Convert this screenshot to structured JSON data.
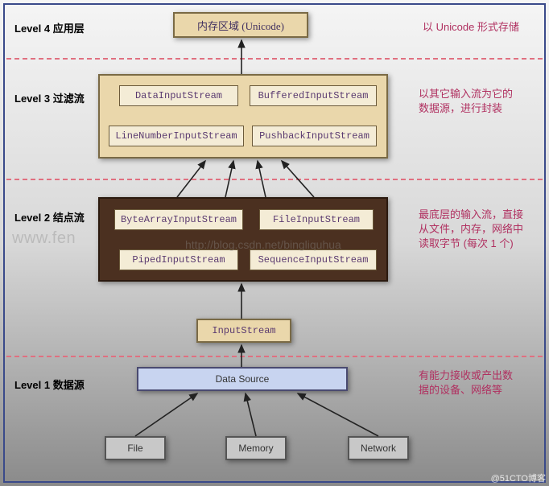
{
  "levels": {
    "l4": {
      "label": "Level 4 应用层",
      "note": "以 Unicode 形式存储",
      "box": "内存区域  (Unicode)"
    },
    "l3": {
      "label": "Level 3 过滤流",
      "note": "以其它输入流为它的\n数据源，进行封装",
      "items": [
        "DataInputStream",
        "BufferedInputStream",
        "LineNumberInputStream",
        "PushbackInputStream"
      ]
    },
    "l2": {
      "label": "Level 2 结点流",
      "note": "最底层的输入流，直接\n从文件，内存，网络中\n读取字节 (每次 1 个)",
      "items": [
        "ByteArrayInputStream",
        "FileInputStream",
        "PipedInputStream",
        "SequenceInputStream"
      ]
    },
    "mid": {
      "box": "InputStream"
    },
    "l1": {
      "label": "Level 1 数据源",
      "note": "有能力接收或产出数\n据的设备、网络等",
      "datasource": "Data Source",
      "sources": [
        "File",
        "Memory",
        "Network"
      ]
    }
  },
  "watermarks": {
    "w1": "www.fen",
    "w2": "http://blog.csdn.net/bingliquhua"
  },
  "badge": "@51CTO博客"
}
